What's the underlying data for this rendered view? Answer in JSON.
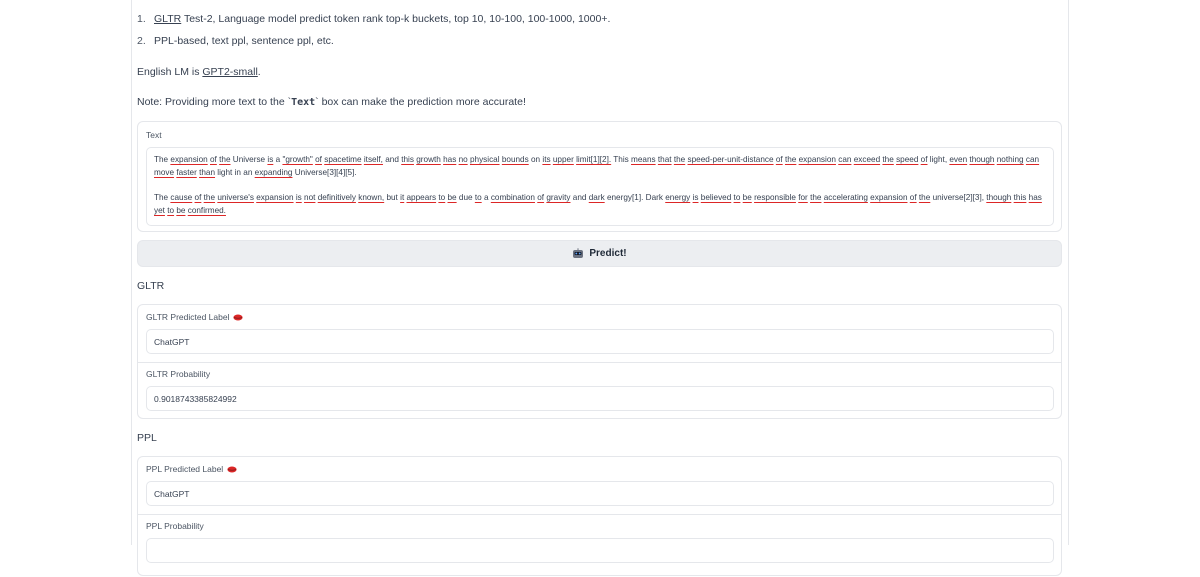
{
  "notes": [
    {
      "num": "1.",
      "link": "GLTR",
      "text": " Test-2, Language model predict token rank top-k buckets, top 10, 10-100, 100-1000, 1000+."
    },
    {
      "num": "2.",
      "text": "PPL-based, text ppl, sentence ppl, etc."
    }
  ],
  "lm_line": {
    "prefix": "English LM is ",
    "link": "GPT2-small",
    "suffix": "."
  },
  "note_line": {
    "prefix": "Note: Providing more text to the `",
    "code": "Text",
    "suffix": "` box can make the prediction more accurate!"
  },
  "text_box": {
    "label": "Text",
    "paragraph1": "The expansion of the Universe is a \"growth\" of spacetime itself, and this growth has no physical bounds on its upper limit[1][2]. This means that the speed-per-unit-distance of the expansion can exceed the speed of light, even though nothing can move faster than light in an expanding Universe[3][4][5].",
    "paragraph2": "The cause of the universe's expansion is not definitively known, but it appears to be due to a combination of gravity and dark energy[1]. Dark energy is believed to be responsible for the accelerating expansion of the universe[2][3], though this has yet to be confirmed."
  },
  "predict_button": {
    "label": "Predict!",
    "icon": "robot-emoji-icon"
  },
  "gltr": {
    "title": "GLTR",
    "predicted_label": {
      "label": "GLTR Predicted Label",
      "icon": "lips-emoji-icon",
      "value": "ChatGPT"
    },
    "probability": {
      "label": "GLTR Probability",
      "value": "0.9018743385824992"
    }
  },
  "ppl": {
    "title": "PPL",
    "predicted_label": {
      "label": "PPL Predicted Label",
      "icon": "lips-emoji-icon",
      "value": "ChatGPT"
    },
    "probability": {
      "label": "PPL Probability",
      "value": ""
    }
  },
  "colors": {
    "underline": "#dc2626",
    "border": "#e5e7eb",
    "button_bg": "#eceef1"
  }
}
